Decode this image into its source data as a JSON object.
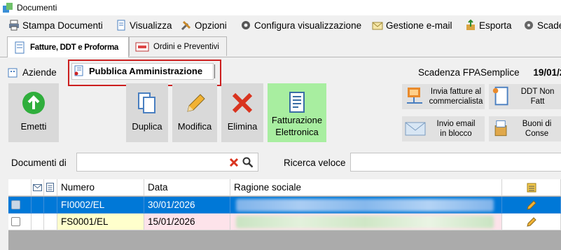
{
  "window": {
    "title": "Documenti"
  },
  "menu": [
    {
      "label": "Stampa Documenti",
      "icon": "printer-icon"
    },
    {
      "label": "Visualizza",
      "icon": "document-icon"
    },
    {
      "label": "Opzioni",
      "icon": "tools-icon"
    },
    {
      "label": "Configura visualizzazione",
      "icon": "gear-icon"
    },
    {
      "label": "Gestione e-mail",
      "icon": "email-icon"
    },
    {
      "label": "Esporta",
      "icon": "export-icon"
    },
    {
      "label": "Scade",
      "icon": "settings-icon"
    }
  ],
  "top_tabs": [
    {
      "label": "Fatture, DDT e Proforma",
      "active": true
    },
    {
      "label": "Ordini e Preventivi",
      "active": false
    }
  ],
  "sub_tabs": [
    {
      "label": "Aziende"
    },
    {
      "label": "Pubblica Amministrazione"
    }
  ],
  "deadline": {
    "label": "Scadenza FPASemplice",
    "date": "19/01/2"
  },
  "toolbar": {
    "emetti": "Emetti",
    "duplica": "Duplica",
    "modifica": "Modifica",
    "elimina": "Elimina",
    "fatturazione": [
      "Fatturazione",
      "Elettronica"
    ],
    "invia_fatture": [
      "Invia fatture al",
      "commercialista"
    ],
    "invio_email": [
      "Invio email",
      "in blocco"
    ],
    "ddt_non_fatt": "DDT Non Fatt",
    "buoni": "Buoni di Conse"
  },
  "search": {
    "documenti_label": "Documenti di",
    "documenti_value": "",
    "ricerca_label": "Ricerca veloce",
    "ricerca_value": ""
  },
  "grid": {
    "columns": [
      "Numero",
      "Data",
      "Ragione sociale"
    ],
    "rows": [
      {
        "numero": "FI0002/EL",
        "data": "30/01/2026",
        "selected": true,
        "checked": true
      },
      {
        "numero": "FS0001/EL",
        "data": "15/01/2026",
        "selected": false,
        "checked": false
      }
    ]
  },
  "colors": {
    "accent": "#0078d7",
    "highlight_red": "#cc1f1f",
    "fe_green": "#a8eea0"
  }
}
